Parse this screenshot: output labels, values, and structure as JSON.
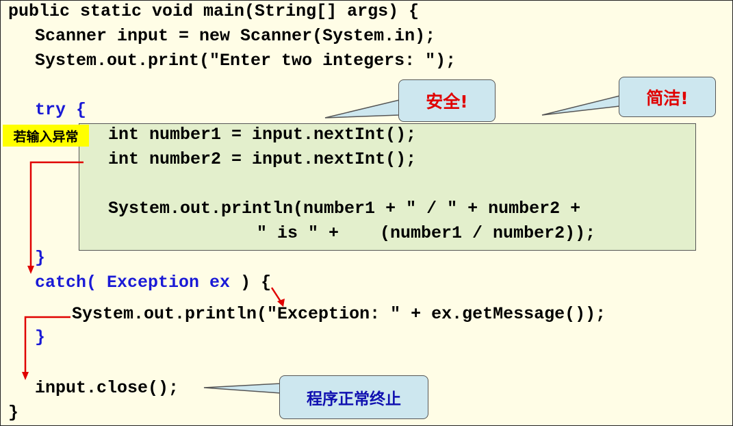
{
  "code": {
    "line1": "public static void main(String[] args) {",
    "line2": "Scanner input = new Scanner(System.in);",
    "line3": "System.out.print(\"Enter two integers: \");",
    "try_kw": "try {",
    "line5": "int number1 = input.nextInt();",
    "line6": "int number2 = input.nextInt();",
    "line7": "System.out.println(number1 + \" / \" + number2 +",
    "line8": "\" is \" +    (number1 / number2));",
    "try_close": "}",
    "catch_kw": "catch(",
    "catch_type": "Exception ex",
    "catch_end": ") {",
    "line11": "System.out.println(\"Exception: \" + ex.getMessage());",
    "catch_close": "}",
    "line13": "input.close();",
    "main_close": "}"
  },
  "callouts": {
    "safe": "安全!",
    "concise": "简洁!",
    "normal_end": "程序正常终止",
    "if_exception": "若输入异常"
  },
  "colors": {
    "background": "#fffde6",
    "keyword": "#1a1ad6",
    "try_box": "#e3efcc",
    "callout": "#cde7ef",
    "red": "#e00000",
    "exception_tag": "#ffff00"
  }
}
